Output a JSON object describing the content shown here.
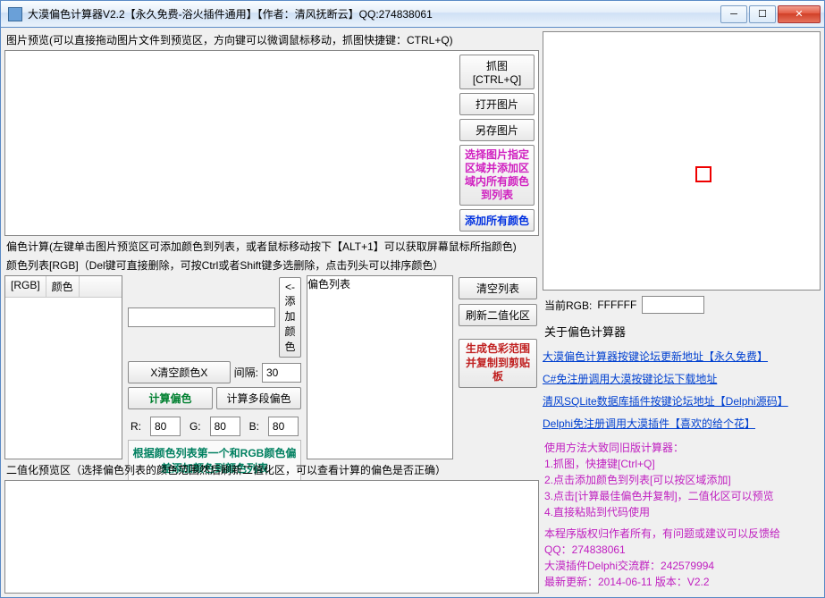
{
  "window": {
    "title": "大漠偏色计算器V2.2【永久免费-浴火插件通用】【作者：清风抚断云】QQ:274838061"
  },
  "labels": {
    "preview": "图片预览(可以直接拖动图片文件到预览区，方向键可以微调鼠标移动，抓图快捷键：CTRL+Q)",
    "calcHint": "偏色计算(左键单击图片预览区可添加颜色到列表，或者鼠标移动按下【ALT+1】可以获取屏幕鼠标所指颜色)",
    "listHint": "颜色列表[RGB]（Del键可直接删除，可按Ctrl或者Shift键多选删除，点击列头可以排序颜色）",
    "binHint": "二值化预览区（选择偏色列表的颜色范围然后刷新二值化区，可以查看计算的偏色是否正确）",
    "interval": "间隔:",
    "r": "R:",
    "g": "G:",
    "b": "B:",
    "currentRgb": "当前RGB:",
    "about": "关于偏色计算器"
  },
  "buttons": {
    "capture": "抓图[CTRL+Q]",
    "openImg": "打开图片",
    "saveImg": "另存图片",
    "selectRegion": "选择图片指定区域并添加区域内所有颜色到列表",
    "addAll": "添加所有颜色",
    "addColor": "<-添加颜色",
    "clearColorX": "X清空颜色X",
    "calcDeviation": "计算偏色",
    "calcMulti": "计算多段偏色",
    "hint": "根据颜色列表第一个和RGB颜色偏差添加颜色到颜色列表",
    "clearList": "清空列表",
    "refreshBin": "刷新二值化区",
    "genRange": "生成色彩范围并复制到剪贴板"
  },
  "headers": {
    "rgb": "[RGB]",
    "color": "颜色",
    "devList": "偏色列表"
  },
  "values": {
    "interval": "30",
    "r": "80",
    "g": "80",
    "b": "80",
    "currentRgb": "FFFFFF",
    "colorInput": ""
  },
  "links": {
    "l1": "大漠偏色计算器按键论坛更新地址【永久免费】",
    "l2": "C#免注册调用大漠按键论坛下载地址",
    "l3": "清风SQLite数据库插件按键论坛地址【Delphi源码】",
    "l4": "Delphi免注册调用大漠插件【喜欢的给个花】"
  },
  "usage": {
    "u0": "使用方法大致同旧版计算器：",
    "u1": "1.抓图，快捷键[Ctrl+Q]",
    "u2": "2.点击添加颜色到列表[可以按区域添加]",
    "u3": "3.点击[计算最佳偏色并复制]，二值化区可以预览",
    "u4": "4.直接粘贴到代码使用",
    "u5": "本程序版权归作者所有，有问题或建议可以反馈给",
    "u6": "QQ：274838061",
    "u7": "大漠插件Delphi交流群：242579994",
    "u8": "最新更新：2014-06-11 版本：V2.2"
  }
}
